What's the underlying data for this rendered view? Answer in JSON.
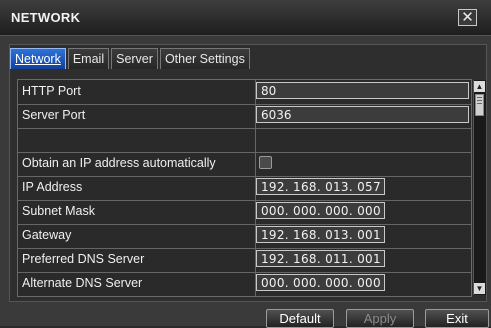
{
  "window": {
    "title": "NETWORK",
    "close_icon": "close-icon"
  },
  "tabs": [
    {
      "label": "Network",
      "active": true
    },
    {
      "label": "Email",
      "active": false
    },
    {
      "label": "Server",
      "active": false
    },
    {
      "label": "Other Settings",
      "active": false
    }
  ],
  "form": {
    "http_port": {
      "label": "HTTP Port",
      "value": "80"
    },
    "server_port": {
      "label": "Server Port",
      "value": "6036"
    },
    "obtain_ip": {
      "label": "Obtain an IP address automatically",
      "checked": false
    },
    "ip_address": {
      "label": "IP Address",
      "value": "192. 168. 013. 057"
    },
    "subnet_mask": {
      "label": "Subnet Mask",
      "value": "000. 000. 000. 000"
    },
    "gateway": {
      "label": "Gateway",
      "value": "192. 168. 013. 001"
    },
    "preferred_dns": {
      "label": "Preferred DNS Server",
      "value": "192. 168. 011. 001"
    },
    "alternate_dns": {
      "label": "Alternate DNS Server",
      "value": "000. 000. 000. 000"
    }
  },
  "buttons": {
    "default": "Default",
    "apply": "Apply",
    "exit": "Exit"
  },
  "colors": {
    "active_tab": "#1f5bc4",
    "background": "#2e2e2e"
  }
}
